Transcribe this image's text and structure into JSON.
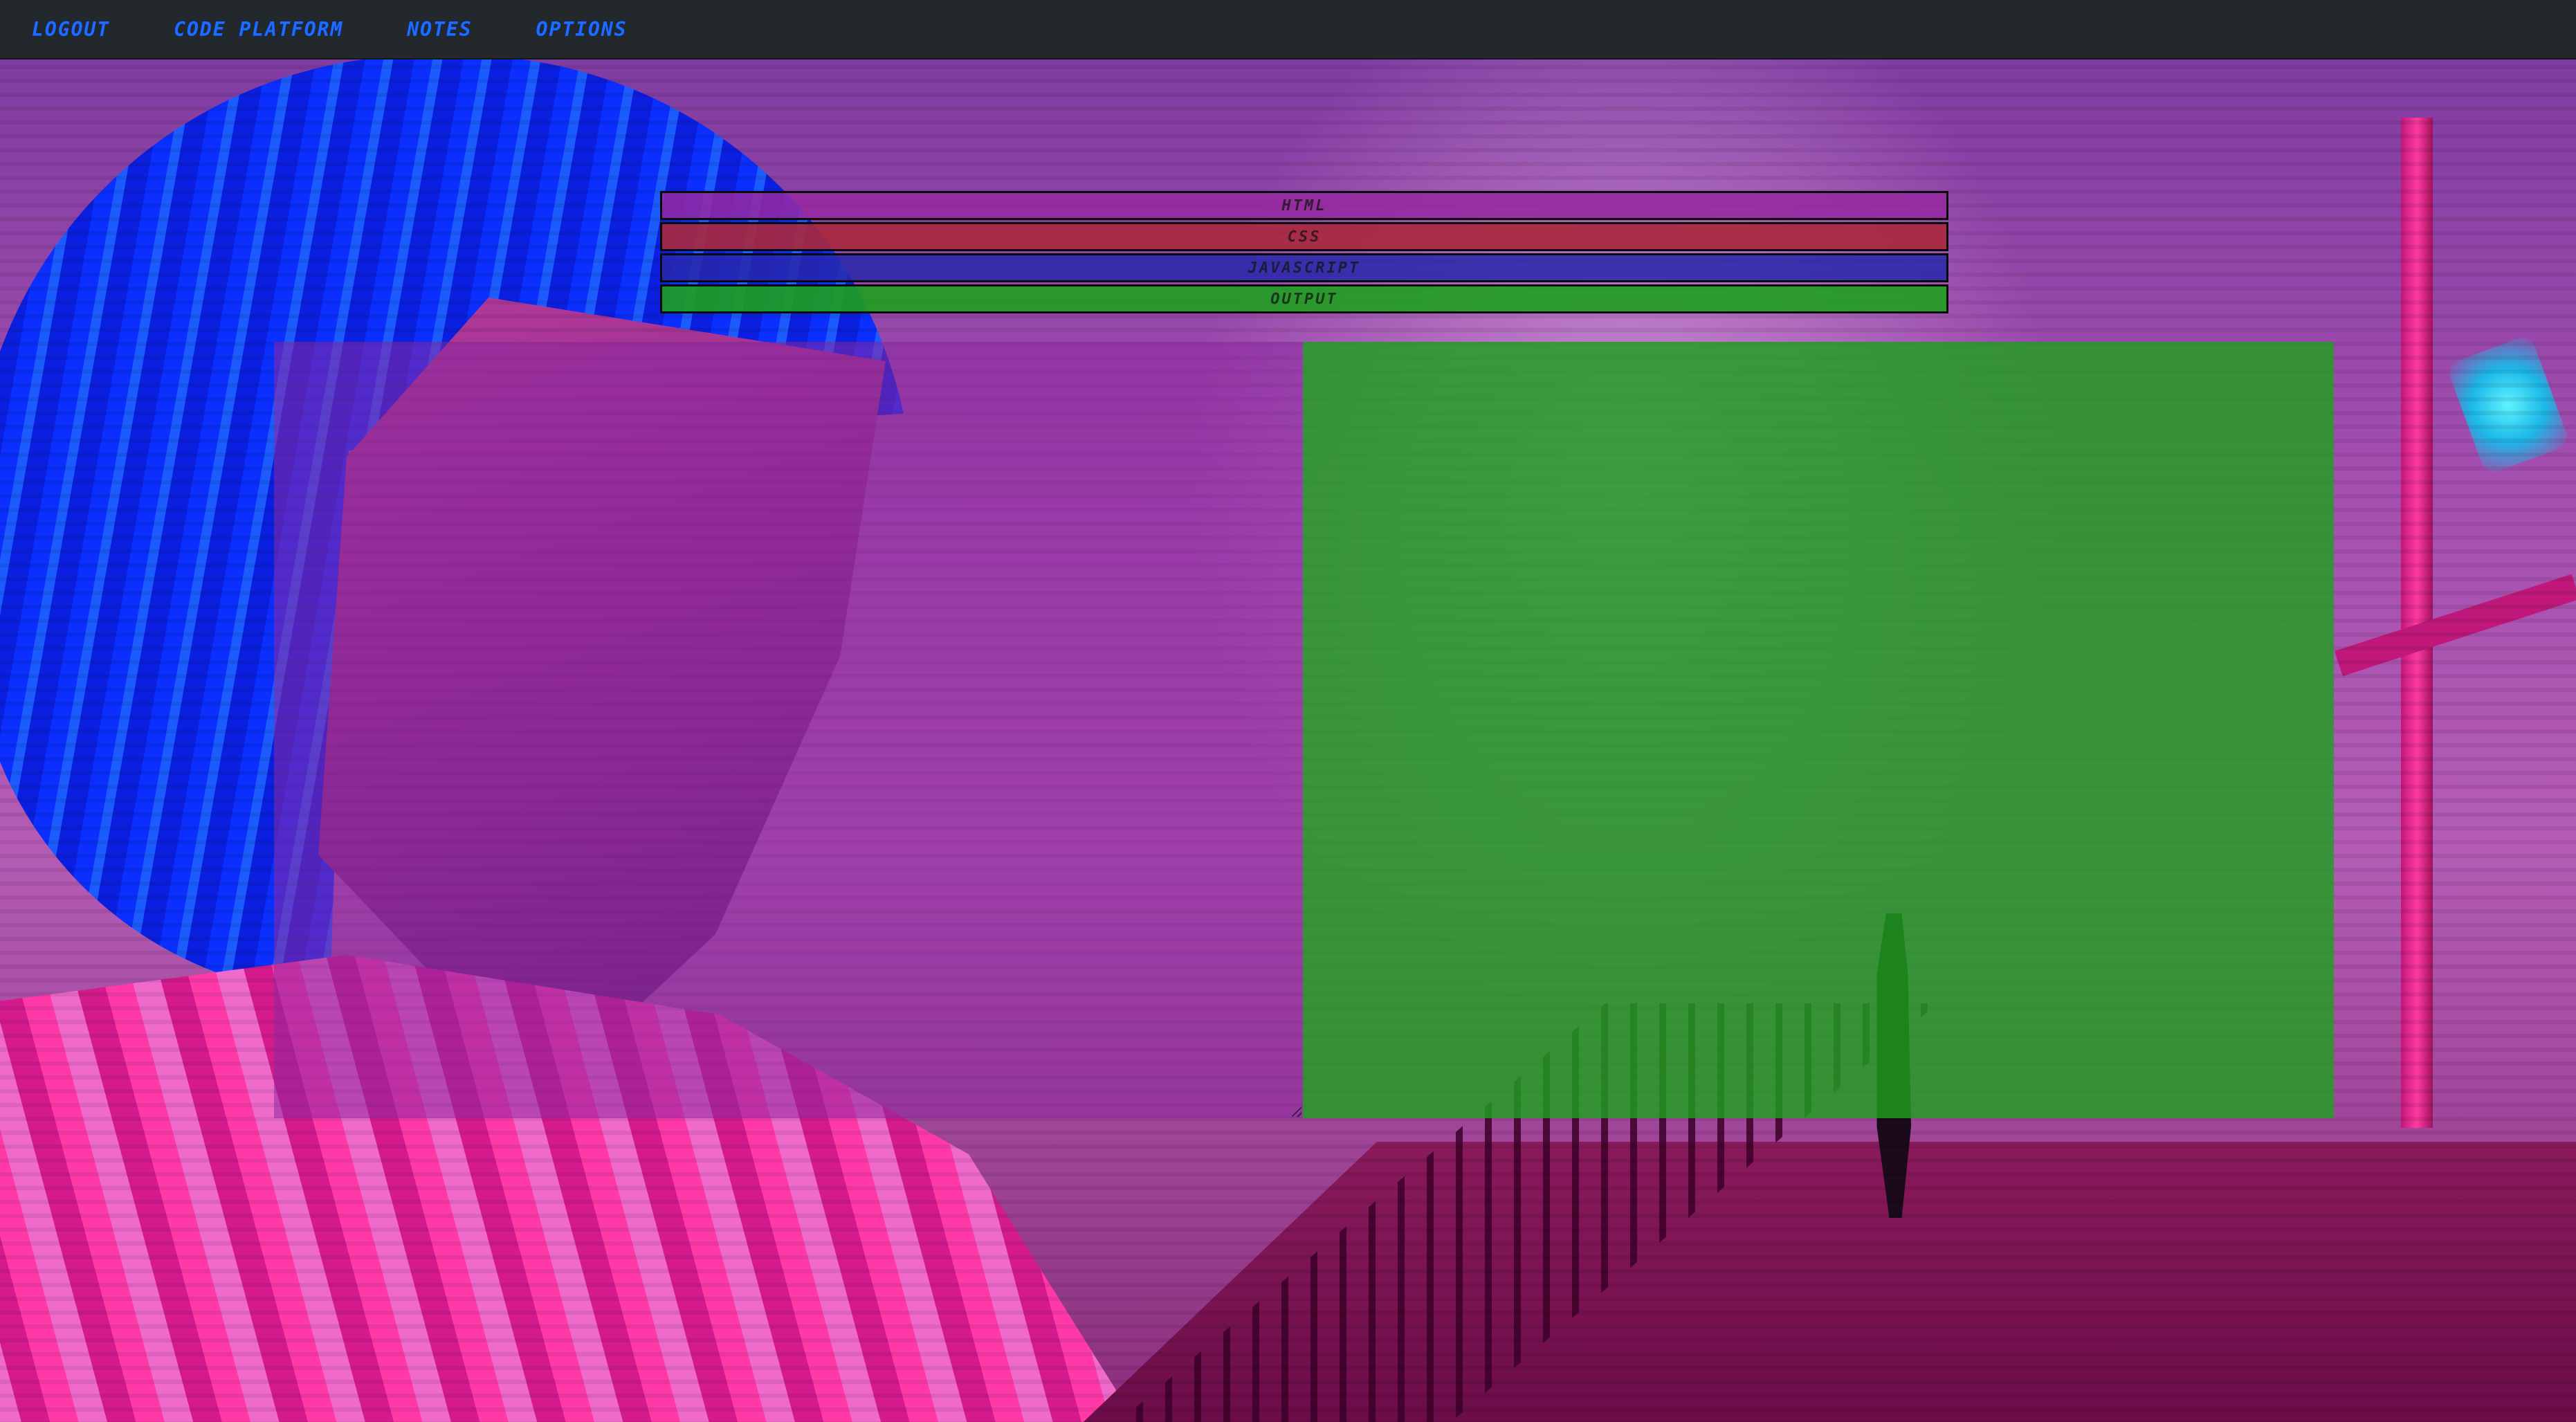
{
  "nav": {
    "items": [
      {
        "label": "LOGOUT"
      },
      {
        "label": "CODE PLATFORM"
      },
      {
        "label": "NOTES"
      },
      {
        "label": "OPTIONS"
      }
    ]
  },
  "tabs": [
    {
      "label": "HTML",
      "color": "#9628a0"
    },
    {
      "label": "CSS",
      "color": "#aa283c"
    },
    {
      "label": "JAVASCRIPT",
      "color": "#2828aa"
    },
    {
      "label": "OUTPUT",
      "color": "#1ea01e"
    }
  ],
  "colors": {
    "navbar_bg": "#23282c",
    "nav_link": "#1e6cff",
    "editor_bg": "#8c28a0",
    "output_bg": "#1ea01e"
  }
}
